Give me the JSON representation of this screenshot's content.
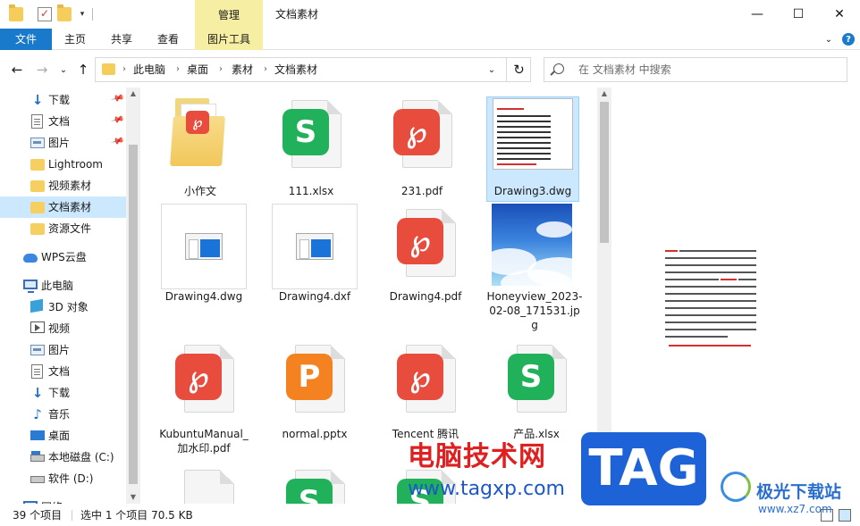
{
  "window": {
    "title": "文档素材",
    "context_tab_group": "管理",
    "controls": {
      "minimize": "—",
      "maximize": "☐",
      "close": "✕"
    }
  },
  "ribbon": {
    "tabs": [
      "文件",
      "主页",
      "共享",
      "查看",
      "图片工具"
    ],
    "expand_glyph": "⌄",
    "help_glyph": "?"
  },
  "address": {
    "crumbs": [
      "此电脑",
      "桌面",
      "素材",
      "文档素材"
    ],
    "separator": "›",
    "dropdown_glyph": "⌄",
    "refresh_glyph": "↻"
  },
  "nav_buttons": {
    "back": "←",
    "forward": "→",
    "recent": "⌄",
    "up": "↑"
  },
  "search": {
    "placeholder": "在 文档素材 中搜索"
  },
  "sidebar": {
    "items": [
      {
        "label": "下载",
        "icon": "download-icon",
        "pinned": true
      },
      {
        "label": "文档",
        "icon": "document-icon",
        "pinned": true
      },
      {
        "label": "图片",
        "icon": "picture-icon",
        "pinned": true
      },
      {
        "label": "Lightroom",
        "icon": "folder-icon"
      },
      {
        "label": "视频素材",
        "icon": "folder-icon"
      },
      {
        "label": "文档素材",
        "icon": "folder-icon",
        "selected": true
      },
      {
        "label": "资源文件",
        "icon": "folder-icon"
      },
      {
        "label": "WPS云盘",
        "icon": "cloud-icon"
      },
      {
        "label": "此电脑",
        "icon": "computer-icon"
      },
      {
        "label": "3D 对象",
        "icon": "3d-objects-icon"
      },
      {
        "label": "视频",
        "icon": "video-icon"
      },
      {
        "label": "图片",
        "icon": "picture-icon"
      },
      {
        "label": "文档",
        "icon": "document-icon"
      },
      {
        "label": "下载",
        "icon": "download-icon"
      },
      {
        "label": "音乐",
        "icon": "music-icon"
      },
      {
        "label": "桌面",
        "icon": "desktop-icon"
      },
      {
        "label": "本地磁盘 (C:)",
        "icon": "drive-icon"
      },
      {
        "label": "软件 (D:)",
        "icon": "drive-icon"
      },
      {
        "label": "网络",
        "icon": "network-icon"
      }
    ]
  },
  "files": [
    {
      "name": "小作文",
      "kind": "folder"
    },
    {
      "name": "111.xlsx",
      "kind": "xlsx",
      "glyph": "S"
    },
    {
      "name": "231.pdf",
      "kind": "pdf",
      "glyph": "P"
    },
    {
      "name": "Drawing3.dwg",
      "kind": "doc-thumb",
      "selected": true
    },
    {
      "name": "Drawing4.dwg",
      "kind": "dialog-thumb"
    },
    {
      "name": "Drawing4.dxf",
      "kind": "dialog-thumb"
    },
    {
      "name": "Drawing4.pdf",
      "kind": "pdf",
      "glyph": "P"
    },
    {
      "name": "Honeyview_2023-02-08_171531.jpg",
      "kind": "sky-thumb"
    },
    {
      "name": "KubuntuManual_加水印.pdf",
      "kind": "pdf",
      "glyph": "P"
    },
    {
      "name": "normal.pptx",
      "kind": "pptx",
      "glyph": "P"
    },
    {
      "name": "Tencent 腾讯",
      "kind": "pdf",
      "glyph": "P"
    },
    {
      "name": "产品.xlsx",
      "kind": "xlsx",
      "glyph": "S"
    },
    {
      "name": "",
      "kind": "blank"
    },
    {
      "name": "",
      "kind": "xlsx",
      "glyph": "S"
    },
    {
      "name": "",
      "kind": "xlsx",
      "glyph": "S"
    }
  ],
  "status": {
    "item_count": "39 个项目",
    "selection": "选中 1 个项目  70.5 KB"
  },
  "watermarks": {
    "cn_text": "电脑技术网",
    "url": "www.tagxp.com",
    "tag": "TAG",
    "site_name": "极光下载站",
    "site_url": "www.xz7.com"
  },
  "colors": {
    "accent": "#1979ca",
    "context_tab": "#f6eea3",
    "selection": "#cce8ff",
    "pdf": "#e84c3d",
    "xlsx": "#20b15a",
    "pptx": "#f58220"
  }
}
